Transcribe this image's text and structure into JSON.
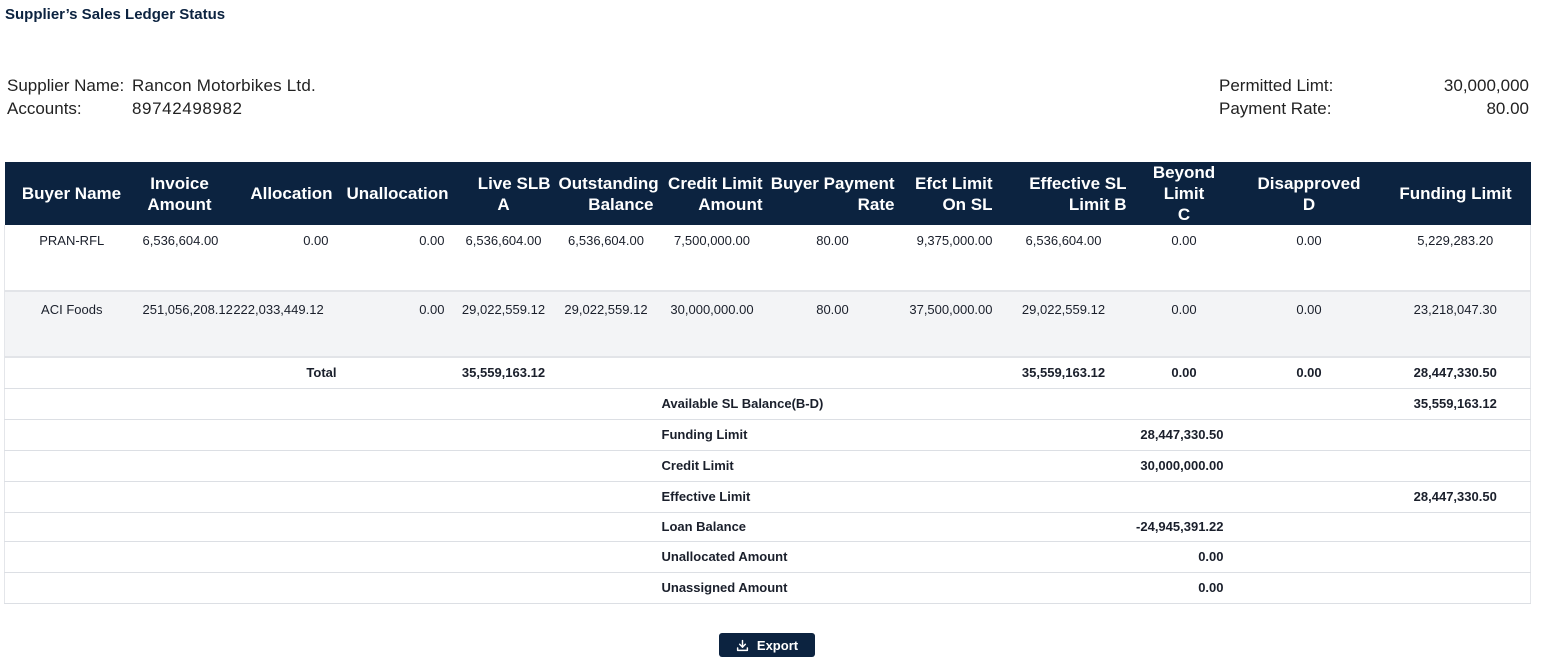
{
  "page": {
    "title": "Supplier’s Sales Ledger Status"
  },
  "supplier": {
    "name_label": "Supplier Name:",
    "name_value": "Rancon Motorbikes Ltd.",
    "accounts_label": "Accounts:",
    "accounts_value": "89742498982",
    "permitted_label": "Permitted Limt:",
    "permitted_value": "30,000,000",
    "payment_rate_label": "Payment Rate:",
    "payment_rate_value": "80.00"
  },
  "table": {
    "headers": {
      "buyer_name": "Buyer Name",
      "invoice_amount_1": "Invoice",
      "invoice_amount_2": "Amount",
      "allocation": "Allocation",
      "unallocation": "Unallocation",
      "live_slb_1": "Live SLB",
      "live_slb_2": "A",
      "outstanding_1": "Outstanding",
      "outstanding_2": "Balance",
      "credit_limit_1": "Credit Limit",
      "credit_limit_2": "Amount",
      "buyer_payment_1": "Buyer Payment",
      "buyer_payment_2": "Rate",
      "efct_limit_1": "Efct Limit",
      "efct_limit_2": "On SL",
      "effective_sl_1": "Effective SL",
      "effective_sl_2": "Limit B",
      "beyond_limit_1": "Beyond Limit",
      "beyond_limit_2": "C",
      "disapproved_1": "Disapproved",
      "disapproved_2": "D",
      "funding_limit": "Funding Limit"
    },
    "rows": [
      {
        "buyer_name": "PRAN-RFL",
        "invoice_amount": "6,536,604.00",
        "allocation": "0.00",
        "unallocation": "0.00",
        "live_slb": "6,536,604.00",
        "outstanding": "6,536,604.00",
        "credit_limit": "7,500,000.00",
        "buyer_payment_rate": "80.00",
        "efct_limit": "9,375,000.00",
        "effective_sl": "6,536,604.00",
        "beyond_limit": "0.00",
        "disapproved": "0.00",
        "funding_limit": "5,229,283.20"
      },
      {
        "buyer_name": "ACI Foods",
        "invoice_amount": "251,056,208.12",
        "allocation": "222,033,449.12",
        "unallocation": "0.00",
        "live_slb": "29,022,559.12",
        "outstanding": "29,022,559.12",
        "credit_limit": "30,000,000.00",
        "buyer_payment_rate": "80.00",
        "efct_limit": "37,500,000.00",
        "effective_sl": "29,022,559.12",
        "beyond_limit": "0.00",
        "disapproved": "0.00",
        "funding_limit": "23,218,047.30"
      }
    ],
    "total": {
      "label": "Total",
      "live_slb": "35,559,163.12",
      "effective_sl": "35,559,163.12",
      "beyond_limit": "0.00",
      "disapproved": "0.00",
      "funding_limit": "28,447,330.50"
    },
    "summary": {
      "available_label": "Available SL Balance(B-D)",
      "available_value": "35,559,163.12",
      "funding_label": "Funding Limit",
      "funding_value": "28,447,330.50",
      "credit_label": "Credit Limit",
      "credit_value": "30,000,000.00",
      "effective_label": "Effective Limit",
      "effective_value": "28,447,330.50",
      "loan_label": "Loan Balance",
      "loan_value": "-24,945,391.22",
      "unallocated_label": "Unallocated Amount",
      "unallocated_value": "0.00",
      "unassigned_label": "Unassigned Amount",
      "unassigned_value": "0.00"
    }
  },
  "actions": {
    "export_label": "Export",
    "export_icon": "download-icon"
  },
  "colors": {
    "header_bg": "#0c2340",
    "header_text": "#ffffff",
    "alt_row_bg": "#f3f4f6"
  }
}
